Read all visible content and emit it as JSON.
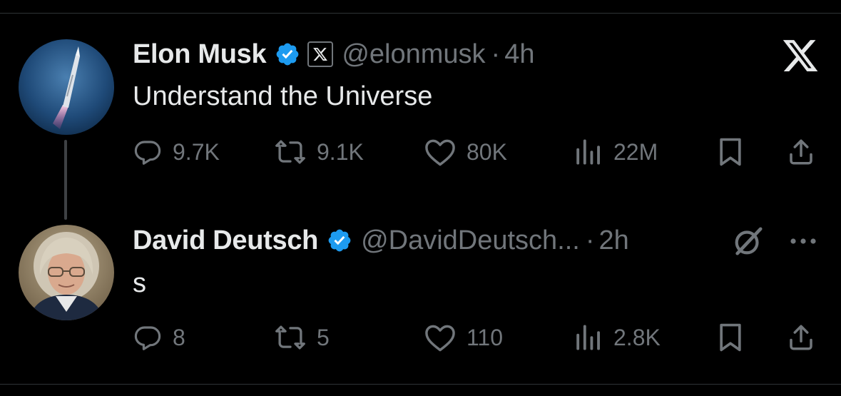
{
  "tweets": [
    {
      "author_name": "Elon Musk",
      "handle": "@elonmusk",
      "separator": "·",
      "time": "4h",
      "text": "Understand the Universe",
      "avatar_icon": "rocket-launch-avatar",
      "affiliation_badge": "x-logo-badge",
      "stats": {
        "replies": "9.7K",
        "reposts": "9.1K",
        "likes": "80K",
        "views": "22M"
      }
    },
    {
      "author_name": "David Deutsch",
      "handle": "@DavidDeutsch...",
      "separator": "·",
      "time": "2h",
      "text": "s",
      "avatar_icon": "portrait-avatar",
      "stats": {
        "replies": "8",
        "reposts": "5",
        "likes": "110",
        "views": "2.8K"
      }
    }
  ],
  "icons": [
    "reply-icon",
    "repost-icon",
    "like-icon",
    "views-icon",
    "bookmark-icon",
    "share-icon",
    "x-logo-icon",
    "grok-icon",
    "more-icon",
    "verified-badge-icon"
  ],
  "colors": {
    "background": "#000000",
    "text": "#e7e9ea",
    "muted": "#71767b",
    "verified": "#1d9bf0",
    "divider": "#2f3336"
  }
}
